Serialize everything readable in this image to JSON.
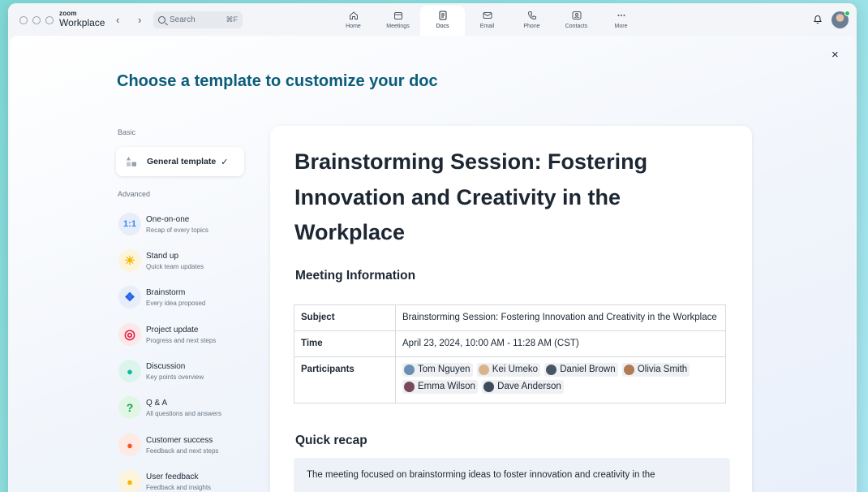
{
  "app": {
    "brand_top": "zoom",
    "brand_bottom": "Workplace",
    "back": "‹",
    "forward": "›",
    "search_placeholder": "Search",
    "search_shortcut": "⌘F"
  },
  "nav_tabs": [
    {
      "label": "Home",
      "icon": "home-icon"
    },
    {
      "label": "Meetings",
      "icon": "calendar-icon"
    },
    {
      "label": "Docs",
      "icon": "document-icon",
      "active": true
    },
    {
      "label": "Email",
      "icon": "mail-icon"
    },
    {
      "label": "Phone",
      "icon": "phone-icon"
    },
    {
      "label": "Contacts",
      "icon": "contacts-icon"
    },
    {
      "label": "More",
      "icon": "more-icon"
    }
  ],
  "dialog": {
    "title": "Choose a template to customize your doc",
    "close": "×",
    "basic_label": "Basic",
    "general_template": "General template",
    "check": "✓",
    "advanced_label": "Advanced",
    "templates": [
      {
        "title": "One-on-one",
        "subtitle": "Recap of every topics",
        "icon": "1:1"
      },
      {
        "title": "Stand up",
        "subtitle": "Quick team updates",
        "icon": "☀"
      },
      {
        "title": "Brainstorm",
        "subtitle": "Every idea proposed",
        "icon": "❖"
      },
      {
        "title": "Project update",
        "subtitle": "Progress and next steps",
        "icon": "◎"
      },
      {
        "title": "Discussion",
        "subtitle": "Key points overview",
        "icon": "●"
      },
      {
        "title": "Q & A",
        "subtitle": "All questions and answers",
        "icon": "?"
      },
      {
        "title": "Customer success",
        "subtitle": "Feedback and next steps",
        "icon": "●"
      },
      {
        "title": "User feedback",
        "subtitle": "Feedback and insights",
        "icon": "●"
      }
    ]
  },
  "preview": {
    "doc_title": "Brainstorming Session: Fostering Innovation and Creativity in the Workplace",
    "meeting_info_heading": "Meeting Information",
    "subject_label": "Subject",
    "subject_value": "Brainstorming Session: Fostering Innovation and Creativity in the Workplace",
    "time_label": "Time",
    "time_value": "April 23, 2024, 10:00 AM - 11:28 AM (CST)",
    "participants_label": "Participants",
    "participants": [
      "Tom Nguyen",
      "Kei Umeko",
      "Daniel Brown",
      "Olivia Smith",
      "Emma Wilson",
      "Dave Anderson"
    ],
    "recap_heading": "Quick recap",
    "recap_text": "The meeting focused on brainstorming ideas to foster innovation and creativity in the"
  },
  "colors": {
    "title_teal": "#0b5c7a",
    "online_green": "#22c55e"
  }
}
